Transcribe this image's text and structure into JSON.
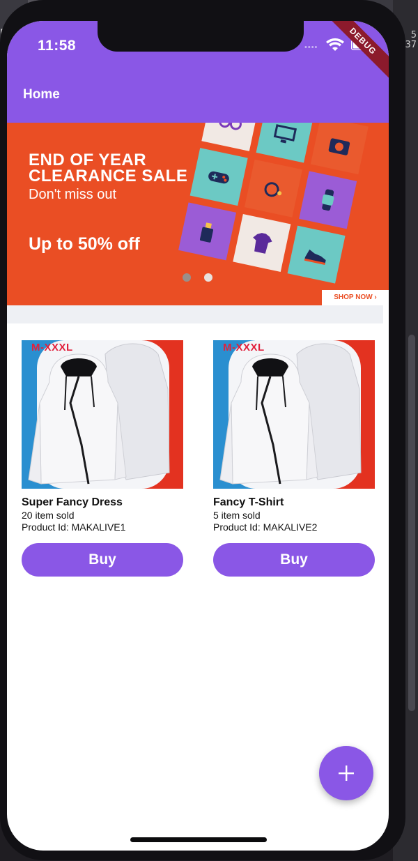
{
  "desktop": {
    "corner_letter": "P",
    "side_note_line1": "5",
    "side_note_line2": "37"
  },
  "status_bar": {
    "time": "11:58",
    "signal_icon": "cellular-signal-icon",
    "wifi_icon": "wifi-icon",
    "battery_icon": "battery-icon",
    "debug_label": "DEBUG"
  },
  "app_bar": {
    "title": "Home",
    "color": "#8a57e6"
  },
  "banner": {
    "line1": "END OF YEAR",
    "line2": "CLEARANCE SALE",
    "line3": "Don't miss out",
    "line4": "Up to 50% off",
    "cta": "SHOP NOW ›",
    "background": "#ea4e24",
    "page_count": 2,
    "active_page": 2
  },
  "products": [
    {
      "size_tag": "M-XXXL",
      "name": "Super Fancy Dress",
      "sold": "20 item sold",
      "product_id": "Product Id: MAKALIVE1",
      "buy_label": "Buy"
    },
    {
      "size_tag": "M-XXXL",
      "name": "Fancy T-Shirt",
      "sold": "5 item sold",
      "product_id": "Product Id: MAKALIVE2",
      "buy_label": "Buy"
    }
  ],
  "fab": {
    "icon": "plus-icon",
    "color": "#8a57e6"
  }
}
